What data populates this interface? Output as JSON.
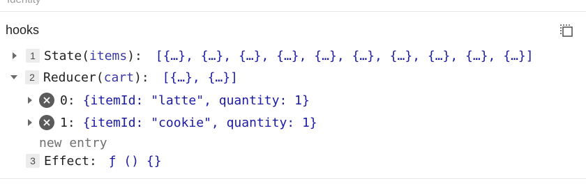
{
  "top_strip": {
    "partial_text": "Identity"
  },
  "section": {
    "title": "hooks"
  },
  "hooks": [
    {
      "index": "1",
      "name": "State",
      "param": "items",
      "value": "[{…}, {…}, {…}, {…}, {…}, {…}, {…}, {…}, {…}, {…}]",
      "expanded": false
    },
    {
      "index": "2",
      "name": "Reducer",
      "param": "cart",
      "value": "[{…}, {…}]",
      "expanded": true,
      "entries": [
        {
          "key": "0:",
          "value": "{itemId: \"latte\", quantity: 1}"
        },
        {
          "key": "1:",
          "value": "{itemId: \"cookie\", quantity: 1}"
        }
      ],
      "new_entry_label": "new entry"
    },
    {
      "index": "3",
      "name": "Effect",
      "value": "ƒ () {}"
    }
  ],
  "icons": {
    "copy": "copy-icon",
    "remove": "remove-circle-icon",
    "expand": "triangle-right-icon",
    "collapse": "triangle-down-icon"
  }
}
